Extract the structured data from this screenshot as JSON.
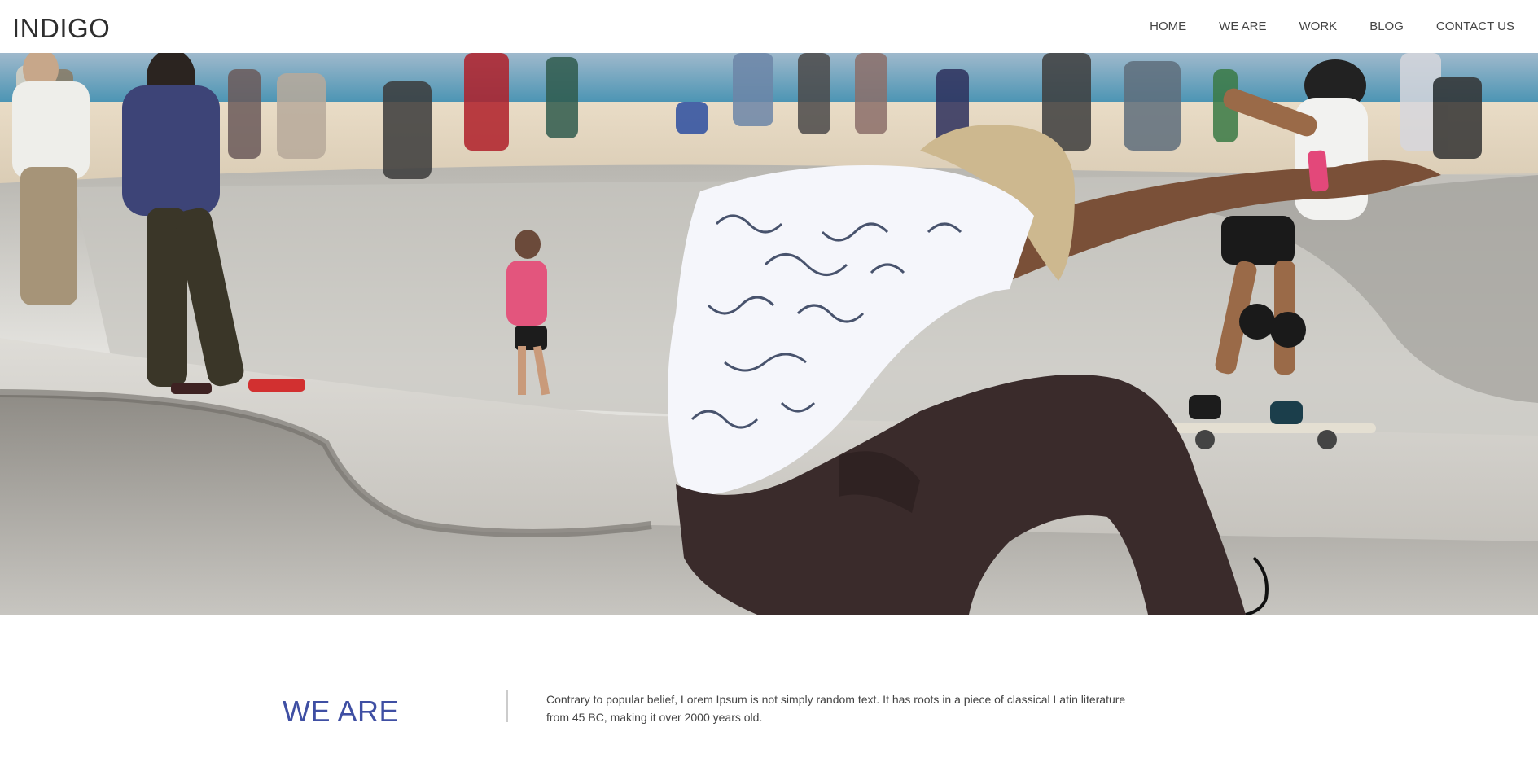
{
  "header": {
    "logo": "INDIGO",
    "nav": [
      {
        "label": "HOME"
      },
      {
        "label": "WE ARE"
      },
      {
        "label": "WORK"
      },
      {
        "label": "BLOG"
      },
      {
        "label": "CONTACT US"
      }
    ]
  },
  "hero": {
    "image": "skateboarder-in-skatepark-photo"
  },
  "we_are": {
    "title": "WE ARE",
    "text": "Contrary to popular belief, Lorem Ipsum is not simply random text. It has roots in a piece of classical Latin literature from 45 BC, making it over 2000 years old."
  },
  "colors": {
    "accent": "#3f4fa3",
    "text": "#444444",
    "background": "#ffffff"
  }
}
